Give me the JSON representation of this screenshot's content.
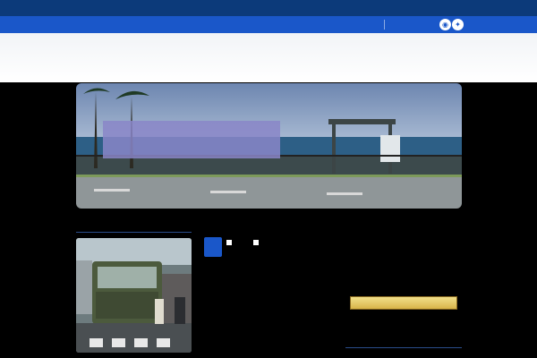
{
  "topbar": {
    "text": ""
  },
  "nav": {
    "home_label": ""
  },
  "social": {
    "rss_icon": "rss-icon",
    "twitter_icon": "twitter-icon"
  },
  "header": {
    "site_title": ""
  },
  "banner": {
    "subtitle": "",
    "title": "",
    "domain": ""
  },
  "section": {
    "latest_label": ""
  },
  "post": {
    "day": "",
    "month": "",
    "category": "",
    "comments": "",
    "title": "",
    "excerpt": ""
  },
  "sidebar": {
    "text": "",
    "banner_label_part1": "",
    "banner_label_part2": "",
    "heading": ""
  },
  "colors": {
    "topbar": "#0c3a7a",
    "navbar": "#1a57c9",
    "accent": "#4a86e8",
    "background": "#000000"
  }
}
